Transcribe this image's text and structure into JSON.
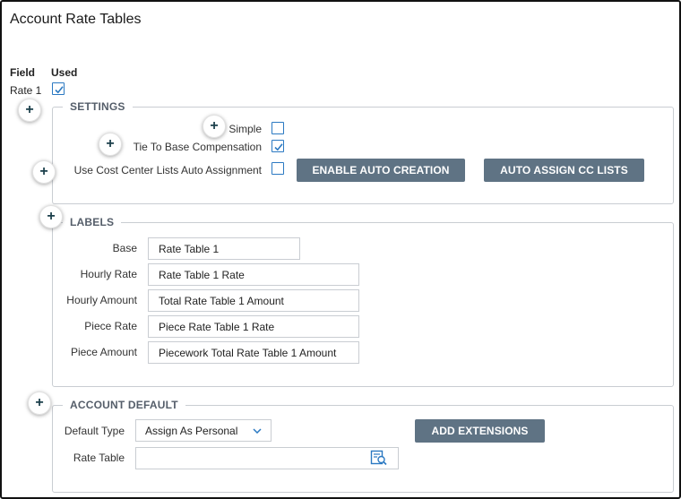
{
  "page": {
    "title": "Account Rate Tables"
  },
  "columns": {
    "field": "Field",
    "used": "Used"
  },
  "row": {
    "label": "Rate 1",
    "used_checked": true
  },
  "settings": {
    "legend": "SETTINGS",
    "simple_label": "Simple",
    "simple_checked": false,
    "tie_label": "Tie To Base Compensation",
    "tie_checked": true,
    "cc_label": "Use Cost Center Lists Auto Assignment",
    "cc_checked": false,
    "enable_button": "ENABLE AUTO CREATION",
    "assign_button": "AUTO ASSIGN CC LISTS"
  },
  "labels": {
    "legend": "LABELS",
    "fields": [
      {
        "label": "Base",
        "value": "Rate Table 1"
      },
      {
        "label": "Hourly Rate",
        "value": "Rate Table 1 Rate"
      },
      {
        "label": "Hourly Amount",
        "value": "Total Rate Table 1 Amount"
      },
      {
        "label": "Piece Rate",
        "value": "Piece Rate Table 1 Rate"
      },
      {
        "label": "Piece Amount",
        "value": "Piecework Total Rate Table 1 Amount"
      }
    ]
  },
  "account_default": {
    "legend": "ACCOUNT DEFAULT",
    "default_type_label": "Default Type",
    "default_type_value": "Assign As Personal",
    "rate_table_label": "Rate Table",
    "rate_table_value": "",
    "add_button": "ADD EXTENSIONS"
  },
  "icons": {
    "plus": "+",
    "accent": "#2b79c2",
    "button_color": "#5f7384",
    "lookup_icon": "search-list-icon"
  }
}
